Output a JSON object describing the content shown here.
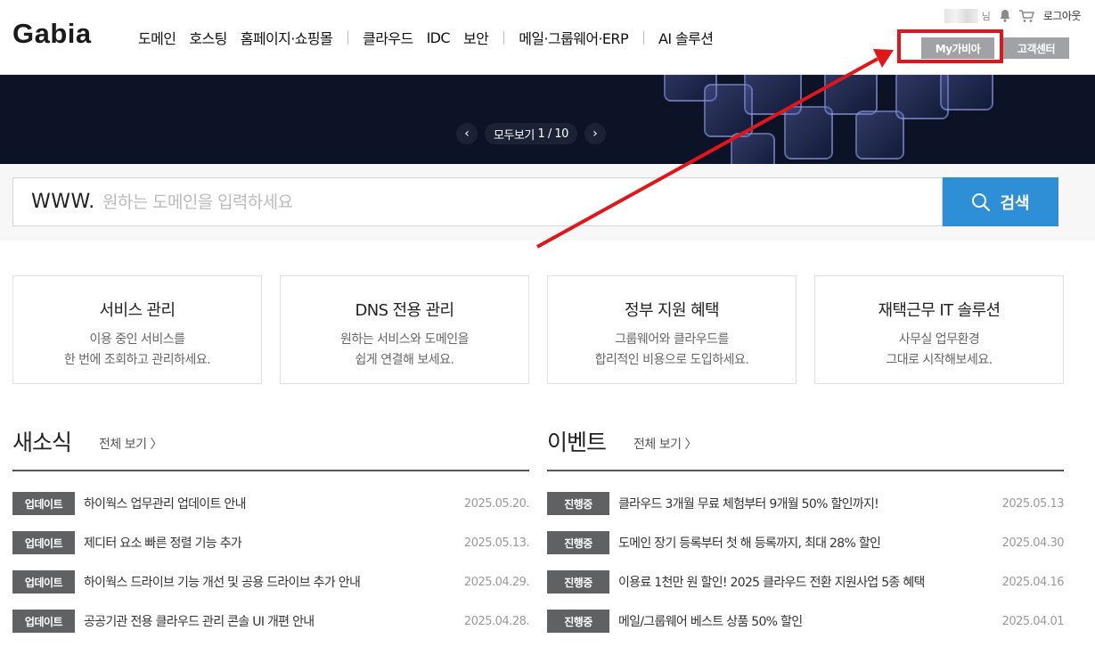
{
  "header": {
    "logo": "Gabia",
    "nav_group1": [
      "도메인",
      "호스팅",
      "홈페이지·쇼핑몰"
    ],
    "nav_group2": [
      "클라우드",
      "IDC",
      "보안"
    ],
    "nav_group3": [
      "메일·그룹웨어·ERP"
    ],
    "nav_group4": [
      "AI 솔루션"
    ],
    "util": {
      "name_suffix": "님",
      "logout": "로그아웃"
    },
    "my_gabia": "My가비아",
    "customer_center": "고객센터"
  },
  "banner": {
    "view_all": "모두보기",
    "page": "1 / 10",
    "prev": "‹",
    "next": "›"
  },
  "search": {
    "prefix": "WWW.",
    "placeholder": "원하는 도메인을 입력하세요",
    "button": "검색"
  },
  "cards": [
    {
      "title": "서비스 관리",
      "line1": "이용 중인 서비스를",
      "line2": "한 번에 조회하고 관리하세요."
    },
    {
      "title": "DNS 전용 관리",
      "line1": "원하는 서비스와 도메인을",
      "line2": "쉽게 연결해 보세요."
    },
    {
      "title": "정부 지원 혜택",
      "line1": "그룹웨어와 클라우드를",
      "line2": "합리적인 비용으로 도입하세요."
    },
    {
      "title": "재택근무 IT 솔루션",
      "line1": "사무실 업무환경",
      "line2": "그대로 시작해보세요."
    }
  ],
  "news": {
    "title": "새소식",
    "more": "전체 보기",
    "items": [
      {
        "badge": "업데이트",
        "text": "하이웍스 업무관리 업데이트 안내",
        "date": "2025.05.20."
      },
      {
        "badge": "업데이트",
        "text": "제디터 요소 빠른 정렬 기능 추가",
        "date": "2025.05.13."
      },
      {
        "badge": "업데이트",
        "text": "하이웍스 드라이브 기능 개선 및 공용 드라이브 추가 안내",
        "date": "2025.04.29."
      },
      {
        "badge": "업데이트",
        "text": "공공기관 전용 클라우드 관리 콘솔 UI 개편 안내",
        "date": "2025.04.28."
      }
    ]
  },
  "events": {
    "title": "이벤트",
    "more": "전체 보기",
    "items": [
      {
        "badge": "진행중",
        "text": "클라우드 3개월 무료 체험부터 9개월 50% 할인까지!",
        "date": "2025.05.13"
      },
      {
        "badge": "진행중",
        "text": "도메인 장기 등록부터 첫 해 등록까지, 최대 28% 할인",
        "date": "2025.04.30"
      },
      {
        "badge": "진행중",
        "text": "이용료 1천만 원 할인! 2025 클라우드 전환 지원사업 5종 혜택",
        "date": "2025.04.16"
      },
      {
        "badge": "진행중",
        "text": "메일/그룹웨어 베스트 상품 50% 할인",
        "date": "2025.04.01"
      }
    ]
  },
  "colors": {
    "search_button": "#2e8ed6",
    "badge": "#5f6163",
    "banner_bg": "#0c1326",
    "annotation": "#e0161b"
  }
}
